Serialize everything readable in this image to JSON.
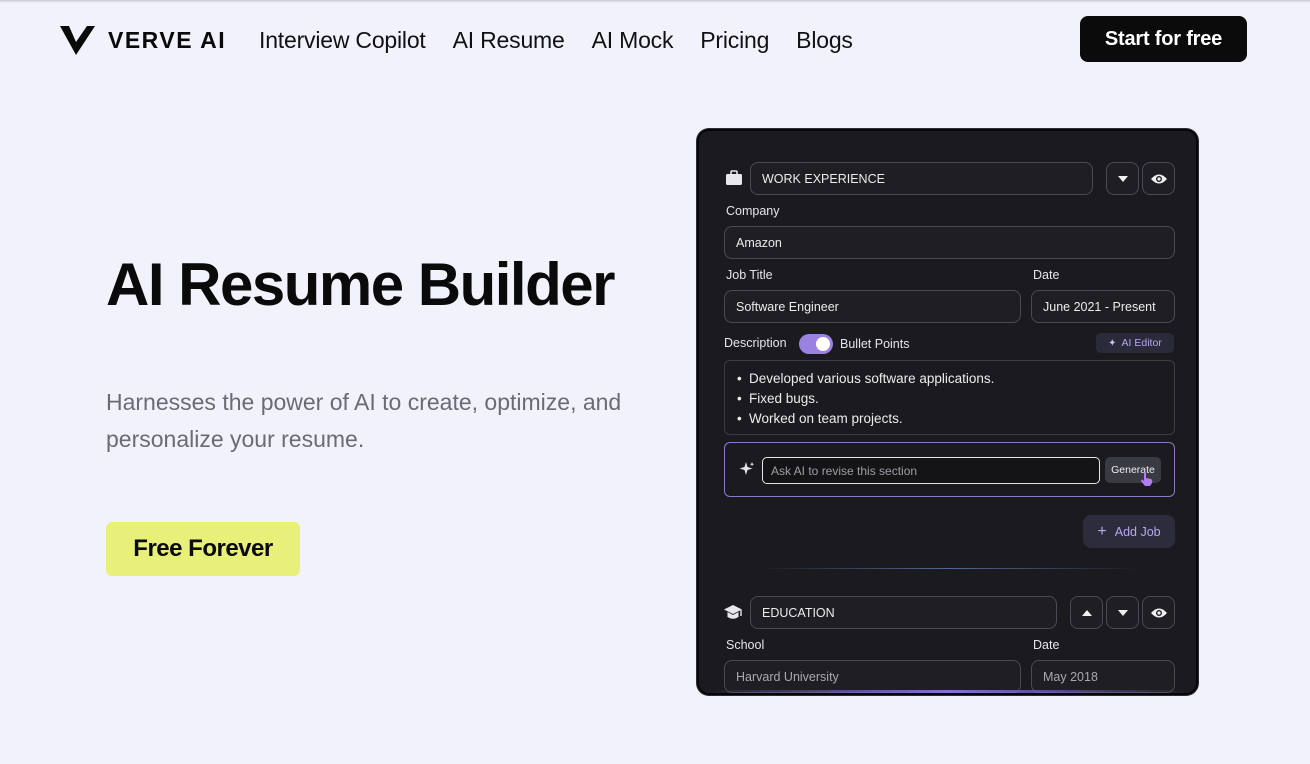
{
  "nav": {
    "brand": "VERVE AI",
    "links": [
      "Interview Copilot",
      "AI Resume",
      "AI Mock",
      "Pricing",
      "Blogs"
    ],
    "cta": "Start for free"
  },
  "hero": {
    "title": "AI Resume Builder",
    "subtitle": "Harnesses the power of AI to create, optimize, and personalize your resume.",
    "button": "Free Forever"
  },
  "editor": {
    "work": {
      "section_title": "WORK EXPERIENCE",
      "company_label": "Company",
      "company_value": "Amazon",
      "job_title_label": "Job Title",
      "job_title_value": "Software Engineer",
      "date_label": "Date",
      "date_value": "June 2021 - Present",
      "description_label": "Description",
      "bullet_toggle_label": "Bullet Points",
      "ai_editor_label": "AI Editor",
      "bullets": [
        "Developed various software applications.",
        "Fixed bugs.",
        "Worked on team projects."
      ],
      "ask_placeholder": "Ask AI to revise this section",
      "generate_label": "Generate",
      "add_job_label": "Add Job"
    },
    "education": {
      "section_title": "EDUCATION",
      "school_label": "School",
      "school_value": "Harvard University",
      "date_label": "Date",
      "date_value": "May 2018"
    }
  }
}
